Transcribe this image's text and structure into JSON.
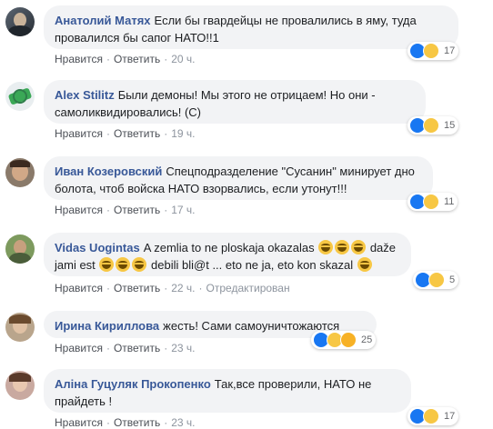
{
  "comments": [
    {
      "author": "Анатолий Матях",
      "text": "Если бы гвардейцы не провалились в яму, туда провалился бы сапог НАТО!!1",
      "reactions": {
        "icons": [
          "like-icon",
          "haha-icon"
        ],
        "count": "17"
      },
      "actions": {
        "like": "Нравится",
        "reply": "Ответить",
        "time": "20 ч."
      }
    },
    {
      "author": "Alex Stilitz",
      "text": "Были демоны! Мы этого не отрицаем! Но они - самоликвидировались! (С)",
      "reactions": {
        "icons": [
          "like-icon",
          "haha-icon"
        ],
        "count": "15"
      },
      "actions": {
        "like": "Нравится",
        "reply": "Ответить",
        "time": "19 ч."
      }
    },
    {
      "author": "Иван Козеровский",
      "text": "Спецподразделение \"Сусанин\" минирует дно болота, чтоб войска НАТО взорвались, если утонут!!!",
      "reactions": {
        "icons": [
          "like-icon",
          "haha-icon"
        ],
        "count": "11"
      },
      "actions": {
        "like": "Нравится",
        "reply": "Ответить",
        "time": "17 ч."
      }
    },
    {
      "author": "Vidas Uogintas",
      "text_part1": "A zemlia to ne ploskaja okazalas",
      "text_part2": "daže jami est",
      "text_part3": "debili bli@t ... eto ne ja, eto kon skazal",
      "reactions": {
        "icons": [
          "like-icon",
          "haha-icon"
        ],
        "count": "5"
      },
      "actions": {
        "like": "Нравится",
        "reply": "Ответить",
        "time": "22 ч.",
        "edited": "Отредактирован"
      }
    },
    {
      "author": "Ирина Кириллова",
      "text": "жесть! Сами самоуничтожаются",
      "reactions": {
        "icons": [
          "like-icon",
          "haha-icon",
          "wow-icon"
        ],
        "count": "25"
      },
      "actions": {
        "like": "Нравится",
        "reply": "Ответить",
        "time": "23 ч."
      }
    },
    {
      "author": "Аліна Гуцуляк Прокопенко",
      "text": "Так,все проверили, НАТО не прайдеть !",
      "reactions": {
        "icons": [
          "like-icon",
          "haha-icon"
        ],
        "count": "17"
      },
      "actions": {
        "like": "Нравится",
        "reply": "Ответить",
        "time": "23 ч."
      }
    }
  ],
  "colors": {
    "author": "#385898",
    "bubble": "#f2f3f5",
    "like": "#1877f2",
    "haha": "#f7c744",
    "meta": "#8d949e"
  }
}
